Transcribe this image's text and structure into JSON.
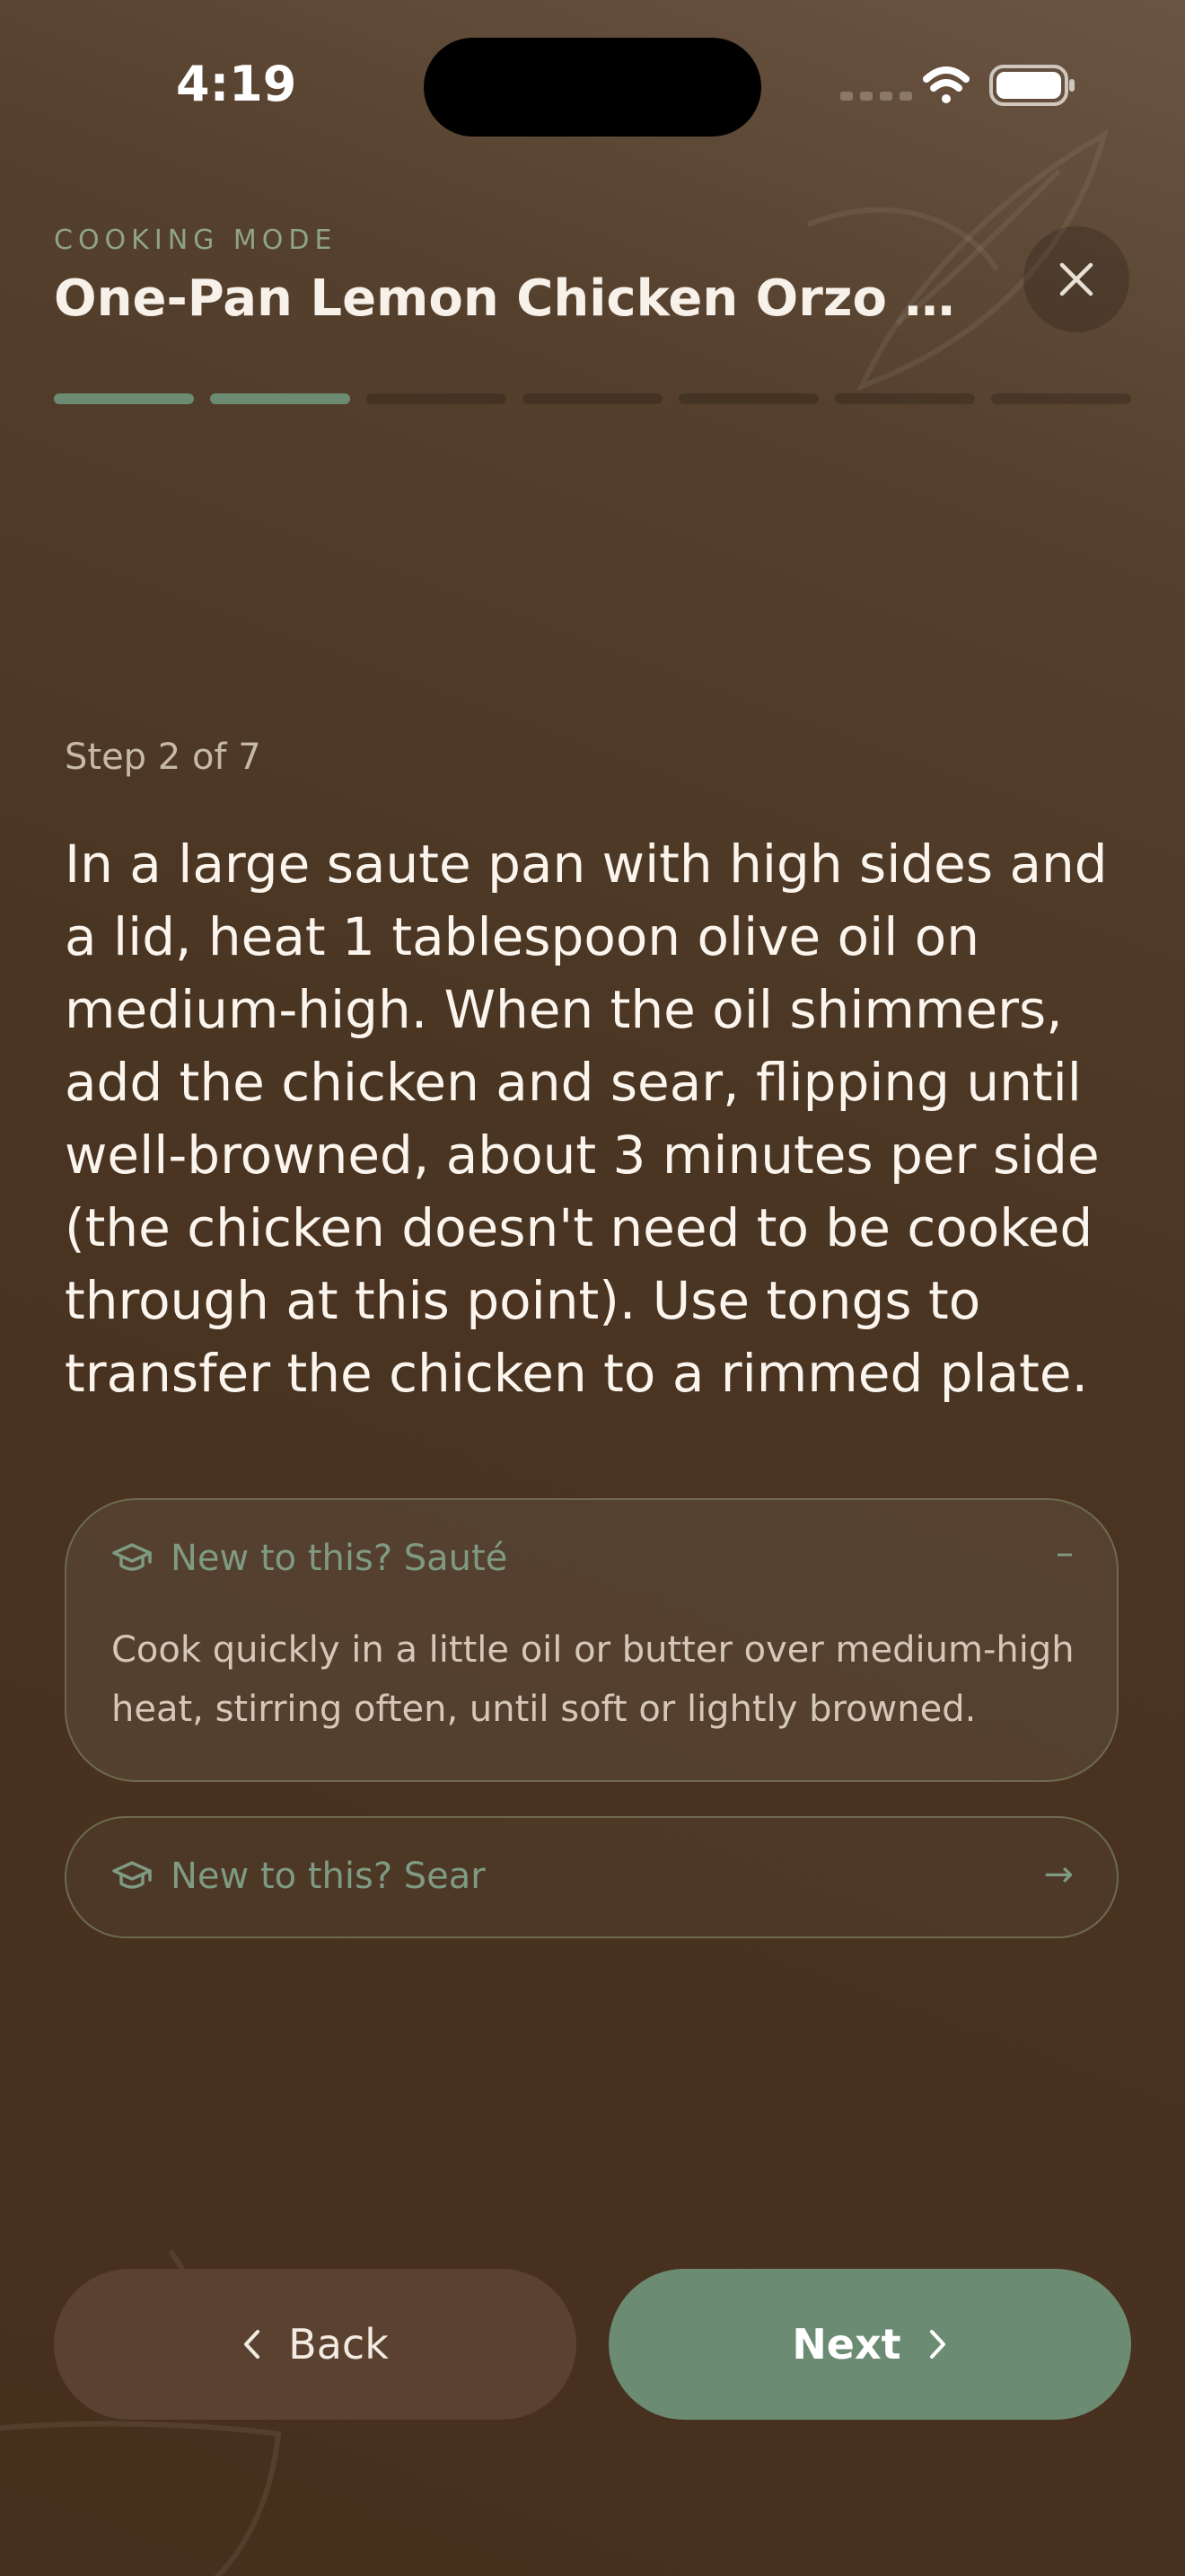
{
  "status_bar": {
    "time": "4:19",
    "icons": [
      "signal-icon",
      "wifi-icon",
      "battery-icon"
    ]
  },
  "header": {
    "eyebrow": "COOKING MODE",
    "title": "One-Pan Lemon Chicken Orzo with ...",
    "close_icon": "close-icon"
  },
  "progress": {
    "total_steps": 7,
    "completed_steps": 2
  },
  "step": {
    "label": "Step 2 of 7",
    "instruction": "In a large saute pan with high sides and a lid, heat 1 tablespoon olive oil on medium-high. When the oil shimmers, add the chicken and sear, flipping until well-browned, about 3 minutes per side (the chicken doesn't need to be cooked through at this point). Use tongs to transfer the chicken to a rimmed plate."
  },
  "tips": [
    {
      "title": "New to this? Sauté",
      "expanded": true,
      "trailing": "–",
      "body": "Cook quickly in a little oil or butter over medium-high heat, stirring often, until soft or lightly browned.",
      "icon": "graduation-cap-icon"
    },
    {
      "title": "New to this? Sear",
      "expanded": false,
      "trailing": "→",
      "icon": "graduation-cap-icon"
    }
  ],
  "nav": {
    "back_label": "Back",
    "next_label": "Next"
  },
  "colors": {
    "accent": "#6b8b73",
    "background": "#4a3422",
    "back_button": "#5b4230"
  }
}
